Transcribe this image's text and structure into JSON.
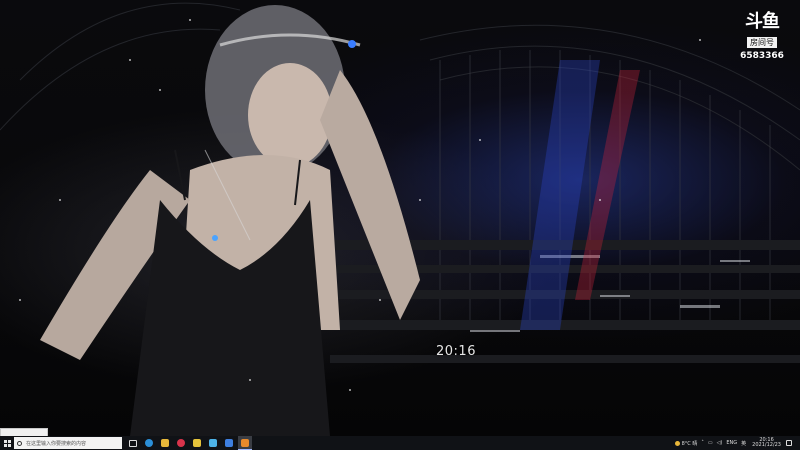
{
  "wallpaper": {
    "description_icon": "anime-character-wallpaper",
    "clock_widget": "20:16"
  },
  "watermark": {
    "logo_text": "斗鱼",
    "badge_text": "房间号",
    "room_id": "6583366"
  },
  "taskbar": {
    "search_placeholder": "在这里输入你要搜索的内容",
    "apps": [
      {
        "name": "task-view-icon",
        "color": "#dddddd"
      },
      {
        "name": "edge-icon",
        "color": "#2b8fd8"
      },
      {
        "name": "file-explorer-icon",
        "color": "#e8b83a"
      },
      {
        "name": "app-red-icon",
        "color": "#d9344b"
      },
      {
        "name": "app-yellow-icon",
        "color": "#e5c33b"
      },
      {
        "name": "app-check-icon",
        "color": "#4db3e8"
      },
      {
        "name": "app-blue-icon",
        "color": "#3e7fe0"
      },
      {
        "name": "app-orange-icon",
        "color": "#e98a2b"
      }
    ],
    "tray": {
      "weather": "8°C 晴",
      "keyboard": "ENG",
      "ime": "英",
      "time": "20:16",
      "date": "2021/12/23"
    }
  }
}
